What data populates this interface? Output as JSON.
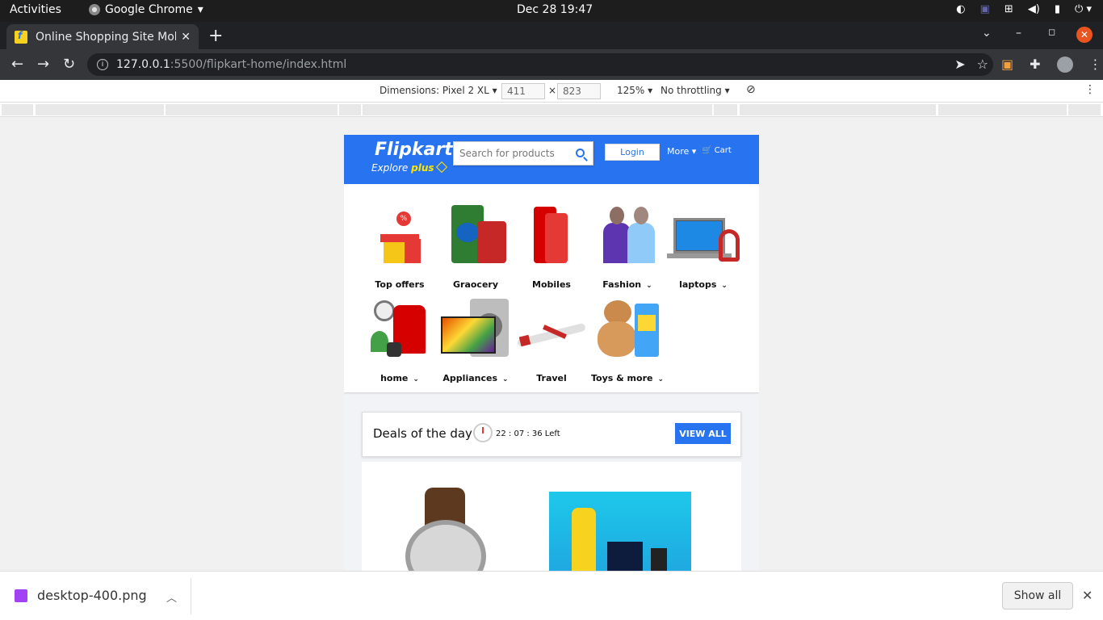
{
  "os": {
    "activities": "Activities",
    "app_name": "Google Chrome",
    "clock": "Dec 28  19:47"
  },
  "browser": {
    "tab_title": "Online Shopping Site Mob",
    "url_host": "127.0.0.1",
    "url_path": ":5500/flipkart-home/index.html"
  },
  "devtools": {
    "dimensions": "Dimensions: Pixel 2 XL",
    "width": "411",
    "height": "823",
    "times": "×",
    "zoom": "125%",
    "throttling": "No throttling"
  },
  "page": {
    "logo": "Flipkart",
    "explore": "Explore",
    "plus": "plus",
    "search_placeholder": "Search for products",
    "login": "Login",
    "more": "More",
    "cart": "Cart",
    "categories": [
      {
        "label": "Top offers"
      },
      {
        "label": "Graocery"
      },
      {
        "label": "Mobiles"
      },
      {
        "label": "Fashion"
      },
      {
        "label": "laptops"
      },
      {
        "label": "home"
      },
      {
        "label": "Appliances"
      },
      {
        "label": "Travel"
      },
      {
        "label": "Toys & more"
      }
    ],
    "deals_title": "Deals of the day",
    "deals_timer": "22 : 07 : 36 Left",
    "view_all": "VIEW ALL"
  },
  "downloads": {
    "file": "desktop-400.png",
    "show_all": "Show all"
  },
  "colors": {
    "flipkart_blue": "#2874f0",
    "flipkart_yellow": "#ffe500"
  }
}
